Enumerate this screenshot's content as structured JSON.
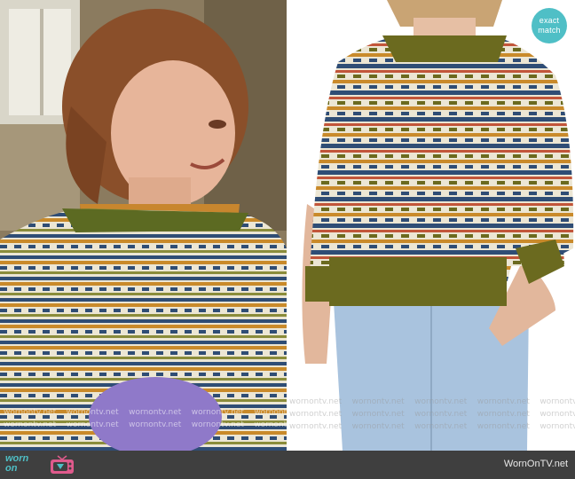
{
  "badge": {
    "line1": "exact",
    "line2": "match"
  },
  "watermark": {
    "text": "wornontv.net",
    "left_rows": [
      [
        "wornontv.net",
        "wornontv.net",
        "wornontv.net",
        "wornontv.net",
        "wornontv.net"
      ],
      [
        "wornontv.net",
        "wornontv.net",
        "wornontv.net",
        "wornontv.net",
        "wornontv.net"
      ]
    ],
    "right_rows": [
      [
        "wornontv.net",
        "wornontv.net",
        "wornontv.net",
        "wornontv.net",
        "wornontv.net"
      ],
      [
        "wornontv.net",
        "wornontv.net",
        "wornontv.net",
        "wornontv.net",
        "wornontv.net"
      ],
      [
        "wornontv.net",
        "wornontv.net",
        "wornontv.net",
        "wornontv.net",
        "wornontv.net"
      ]
    ]
  },
  "footer": {
    "logo_line1": "worn",
    "logo_line2": "on",
    "site_name": "WornOnTV.net"
  },
  "colors": {
    "brand": "#4fbfc6",
    "footer_bg": "#3f3f3f",
    "sweater_olive": "#6b6a1f",
    "sweater_navy": "#2f4d75",
    "sweater_mustard": "#c98a2a",
    "sweater_rust": "#c2553a",
    "sweater_cream": "#ece6d4"
  }
}
